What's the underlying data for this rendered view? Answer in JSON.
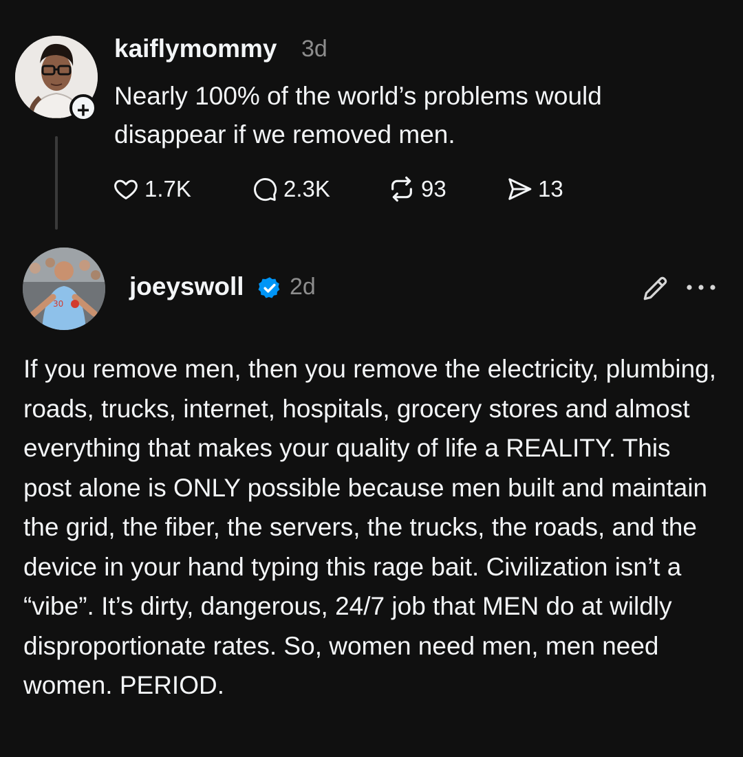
{
  "post": {
    "username": "kaiflymommy",
    "time": "3d",
    "follow_symbol": "+",
    "text": "Nearly 100% of the world’s problems would disappear if we removed men.",
    "stats": {
      "likes": "1.7K",
      "replies": "2.3K",
      "reposts": "93",
      "shares": "13"
    }
  },
  "reply": {
    "username": "joeyswoll",
    "verified": true,
    "time": "2d",
    "text": "If you remove men, then you remove the electricity, plumbing, roads, trucks, internet, hospitals, grocery stores and almost everything that makes your quality of life a REALITY. This post alone is ONLY possible because men built and maintain the grid, the fiber, the servers, the trucks, the roads, and the device in your hand typing this rage bait. Civilization isn’t a “vibe”. It’s dirty, dangerous, 24/7 job that MEN do at wildly disproportionate rates. So, women need men, men need women. PERIOD."
  },
  "colors": {
    "background": "#101010",
    "text": "#f3f5f7",
    "muted": "#8d8d8d",
    "verified": "#0095f6"
  }
}
